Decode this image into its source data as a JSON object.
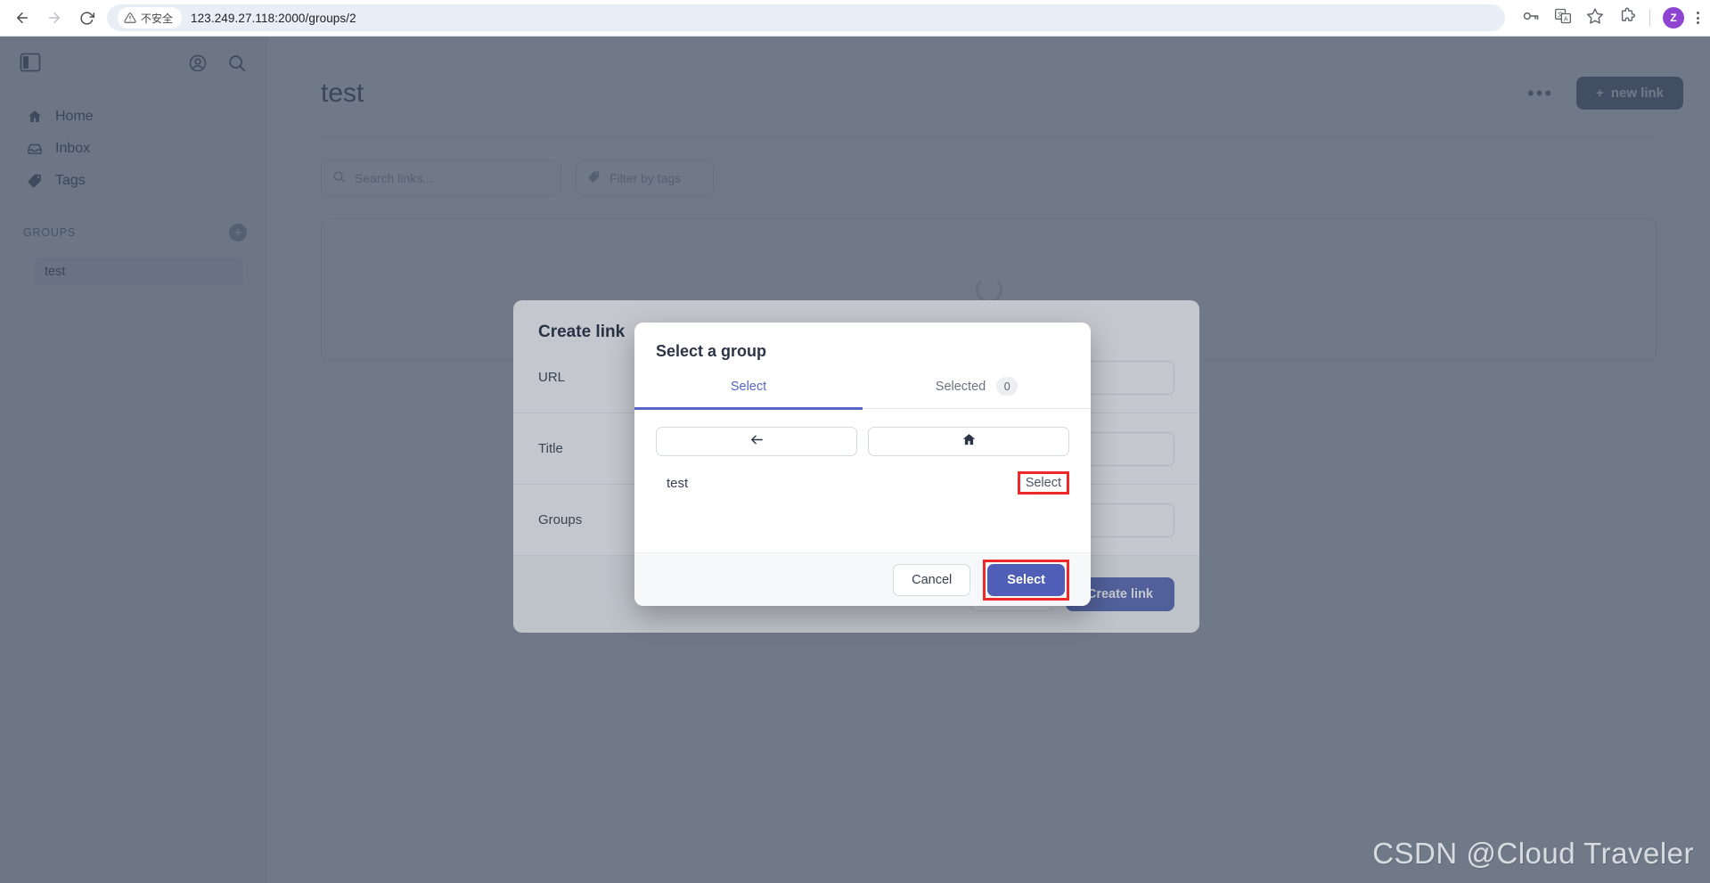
{
  "browser": {
    "back_icon": "back-arrow-icon",
    "forward_icon": "forward-arrow-icon",
    "reload_icon": "reload-icon",
    "security_label": "不安全",
    "url": "123.249.27.118:2000/groups/2",
    "password_icon": "key-icon",
    "translate_icon": "translate-icon",
    "bookmark_icon": "star-icon",
    "extensions_icon": "puzzle-icon",
    "profile_initial": "Z",
    "menu_icon": "kebab-menu-icon"
  },
  "sidebar": {
    "panel_toggle_icon": "sidebar-panel-icon",
    "account_icon": "account-circle-icon",
    "search_icon": "search-icon",
    "items": [
      {
        "label": "Home",
        "icon": "home-icon"
      },
      {
        "label": "Inbox",
        "icon": "inbox-icon"
      },
      {
        "label": "Tags",
        "icon": "tag-icon"
      }
    ],
    "groups_section_label": "groups",
    "add_group_icon": "plus-circle-icon",
    "groups": [
      {
        "label": "test"
      }
    ]
  },
  "main": {
    "page_title": "test",
    "more_menu_label": "•••",
    "new_link_label": "new link",
    "new_link_plus": "+",
    "search_placeholder": "Search links...",
    "tags_placeholder": "Filter by tags"
  },
  "create_dialog": {
    "title": "Create link",
    "fields": [
      {
        "label": "URL",
        "value": ""
      },
      {
        "label": "Title",
        "value": ""
      },
      {
        "label": "Groups",
        "value": ""
      }
    ],
    "cancel_label": "Cancel",
    "submit_label": "Create link"
  },
  "select_group_dialog": {
    "title": "Select a group",
    "tabs": [
      {
        "label": "Select",
        "active": true
      },
      {
        "label": "Selected",
        "active": false,
        "badge": "0"
      }
    ],
    "nav_back_icon": "arrow-left-icon",
    "nav_home_icon": "home-icon",
    "rows": [
      {
        "label": "test",
        "action_label": "Select"
      }
    ],
    "cancel_label": "Cancel",
    "submit_label": "Select"
  },
  "watermark": "CSDN @Cloud Traveler",
  "colors": {
    "accent_blue": "#4f5fb8",
    "highlight_red": "#ef2929",
    "scrim": "#3c485c",
    "new_link_btn": "#555f78",
    "avatar": "#8e44d0"
  }
}
